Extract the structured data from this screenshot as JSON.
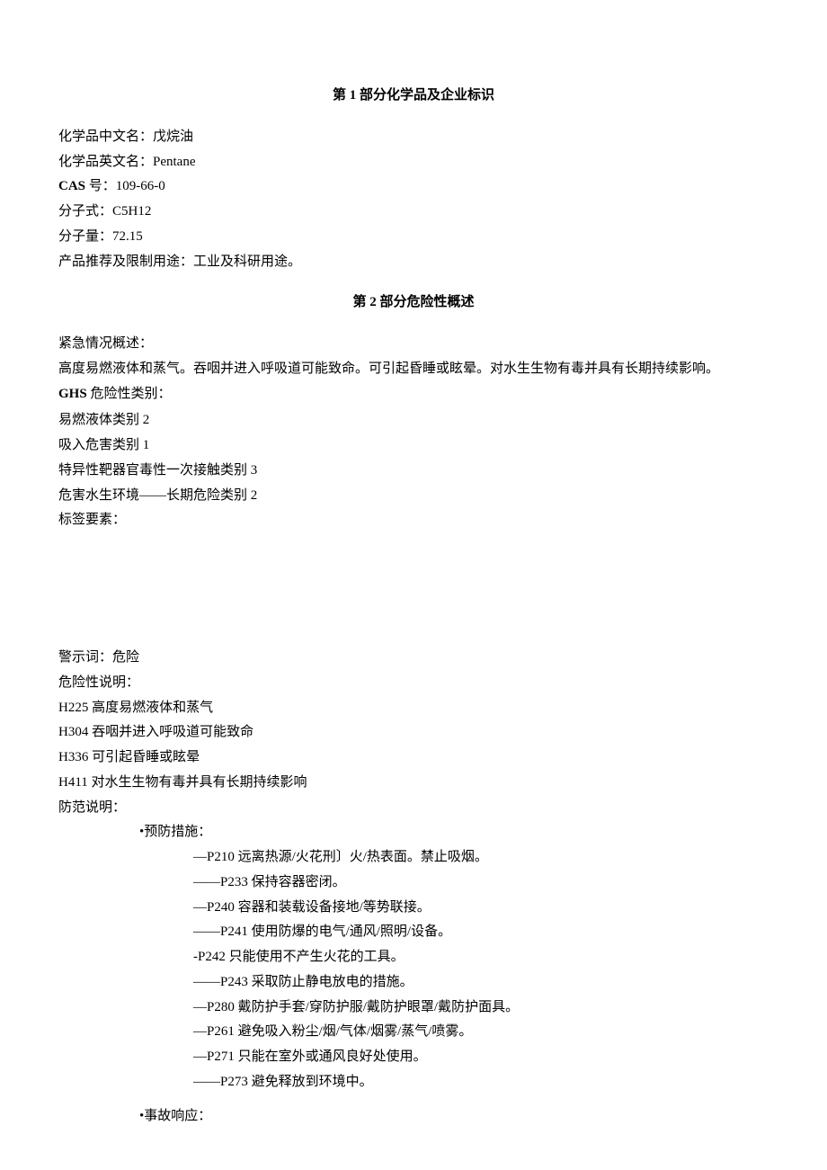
{
  "section1": {
    "title_prefix": "第 ",
    "title_num": "1",
    "title_suffix": " 部分化学品及企业标识",
    "chinese_name_label": "化学品中文名：",
    "chinese_name_value": "戊烷油",
    "english_name_label": "化学品英文名：",
    "english_name_value": "Pentane",
    "cas_label": "CAS ",
    "cas_label2": "号：",
    "cas_value": "109-66-0",
    "formula_label": "分子式：",
    "formula_value": "C5H12",
    "weight_label": "分子量：",
    "weight_value": "72.15",
    "use_label": "产品推荐及限制用途：",
    "use_value": "工业及科研用途。"
  },
  "section2": {
    "title_prefix": "第 ",
    "title_num": "2",
    "title_suffix": " 部分危险性概述",
    "emergency_label": "紧急情况概述：",
    "emergency_text": "高度易燃液体和蒸气。吞咽并进入呼吸道可能致命。可引起昏睡或眩晕。对水生生物有毒并具有长期持续影响。",
    "ghs_label": "GHS ",
    "ghs_label2": "危险性类别：",
    "ghs_cat1": "易燃液体类别 2",
    "ghs_cat2": "吸入危害类别 1",
    "ghs_cat3": "特异性靶器官毒性一次接触类别 3",
    "ghs_cat4": "危害水生环境——长期危险类别 2",
    "label_elements": "标签要素：",
    "signal_label": "警示词：",
    "signal_value": "危险",
    "hazard_stmt_label": "危险性说明：",
    "h225": "H225 高度易燃液体和蒸气",
    "h304": "H304 吞咽并进入呼吸道可能致命",
    "h336": "H336 可引起昏睡或眩晕",
    "h411": "H411 对水生生物有毒并具有长期持续影响",
    "precaution_label": "防范说明：",
    "prevention_header": "•预防措施：",
    "p210": "—P210 远离热源/火花刑〕火/热表面。禁止吸烟。",
    "p233": "——P233 保持容器密闭。",
    "p240": "—P240 容器和装载设备接地/等势联接。",
    "p241": "——P241 使用防爆的电气/通风/照明/设备。",
    "p242": "-P242 只能使用不产生火花的工具。",
    "p243": "——P243 采取防止静电放电的措施。",
    "p280": "—P280 戴防护手套/穿防护服/戴防护眼罩/戴防护面具。",
    "p261": "—P261 避免吸入粉尘/烟/气体/烟雾/蒸气/喷雾。",
    "p271": "—P271 只能在室外或通风良好处使用。",
    "p273": "——P273 避免释放到环境中。",
    "response_header": "•事故响应："
  }
}
